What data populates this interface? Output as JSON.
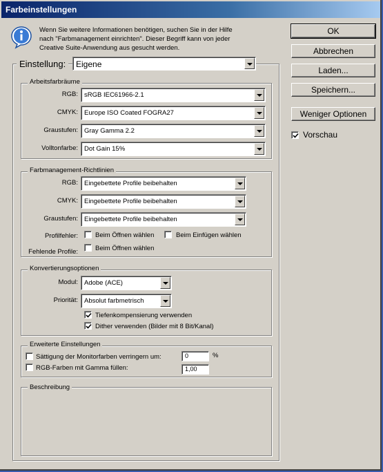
{
  "window": {
    "title": "Farbeinstellungen"
  },
  "info": {
    "icon": "info-icon",
    "lines": [
      "Wenn Sie weitere Informationen benötigen, suchen Sie in der Hilfe",
      "nach \"Farbmanagement einrichten\". Dieser Begriff kann von jeder",
      "Creative Suite-Anwendung aus gesucht werden."
    ]
  },
  "buttons": {
    "ok": "OK",
    "cancel": "Abbrechen",
    "load": "Laden...",
    "save": "Speichern...",
    "fewer_options": "Weniger Optionen"
  },
  "preview": {
    "label": "Vorschau",
    "checked": true
  },
  "setting": {
    "label": "Einstellung:",
    "value": "Eigene"
  },
  "workspaces": {
    "title": "Arbeitsfarbräume",
    "rgb": {
      "label": "RGB:",
      "value": "sRGB IEC61966-2.1"
    },
    "cmyk": {
      "label": "CMYK:",
      "value": "Europe ISO Coated FOGRA27"
    },
    "gray": {
      "label": "Graustufen:",
      "value": "Gray Gamma 2.2"
    },
    "spot": {
      "label": "Volltonfarbe:",
      "value": "Dot Gain 15%"
    }
  },
  "policies": {
    "title": "Farbmanagement-Richtlinien",
    "rgb": {
      "label": "RGB:",
      "value": "Eingebettete Profile beibehalten"
    },
    "cmyk": {
      "label": "CMYK:",
      "value": "Eingebettete Profile beibehalten"
    },
    "gray": {
      "label": "Graustufen:",
      "value": "Eingebettete Profile beibehalten"
    },
    "mismatch_label": "Profilfehler:",
    "mismatch_open": {
      "label": "Beim Öffnen wählen",
      "checked": false
    },
    "mismatch_paste": {
      "label": "Beim Einfügen wählen",
      "checked": false
    },
    "missing_label": "Fehlende Profile:",
    "missing_open": {
      "label": "Beim Öffnen wählen",
      "checked": false
    }
  },
  "conversion": {
    "title": "Konvertierungsoptionen",
    "engine": {
      "label": "Modul:",
      "value": "Adobe (ACE)"
    },
    "intent": {
      "label": "Priorität:",
      "value": "Absolut farbmetrisch"
    },
    "bpc": {
      "label": "Tiefenkompensierung verwenden",
      "checked": true
    },
    "dither": {
      "label": "Dither verwenden (Bilder mit 8 Bit/Kanal)",
      "checked": true
    }
  },
  "advanced": {
    "title": "Erweiterte Einstellungen",
    "desaturate": {
      "label": "Sättigung der Monitorfarben verringern um:",
      "value": "0",
      "unit": "%",
      "checked": false
    },
    "blend": {
      "label": "RGB-Farben mit Gamma füllen:",
      "value": "1,00",
      "checked": false
    }
  },
  "description": {
    "title": "Beschreibung"
  }
}
